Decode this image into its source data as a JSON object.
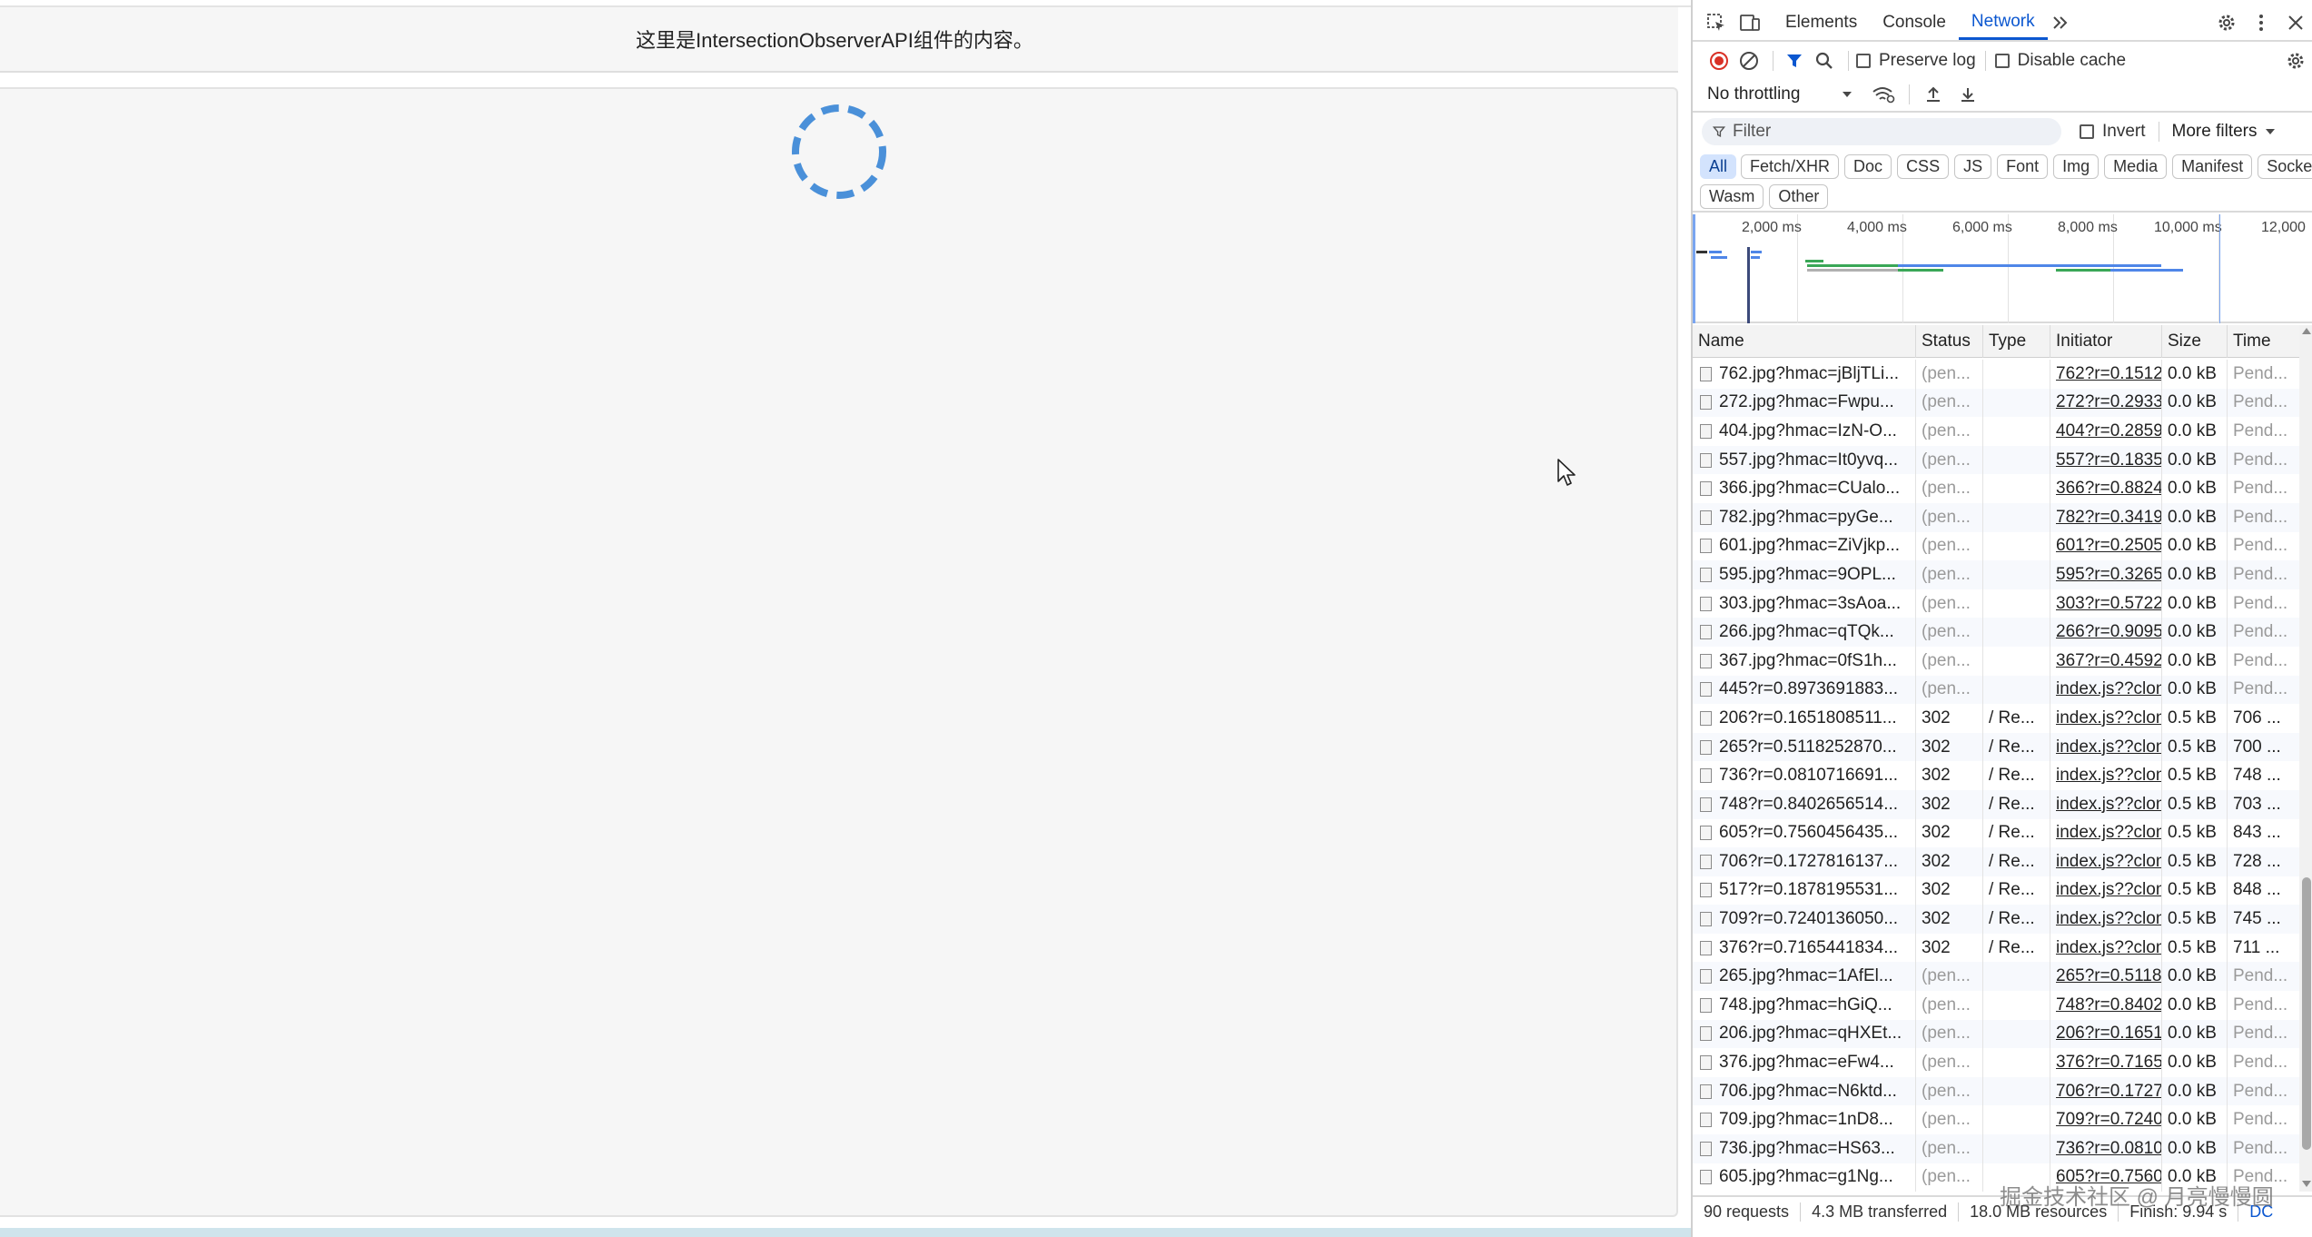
{
  "page": {
    "header_text": "这里是IntersectionObserverAPI组件的内容。"
  },
  "devtools": {
    "tabs": [
      "Elements",
      "Console",
      "Network"
    ],
    "active_tab": "Network",
    "toolbar": {
      "preserve_log": "Preserve log",
      "disable_cache": "Disable cache",
      "throttling": "No throttling"
    },
    "filter": {
      "placeholder": "Filter",
      "invert": "Invert",
      "more_filters": "More filters"
    },
    "type_filters_row1": [
      "All",
      "Fetch/XHR",
      "Doc",
      "CSS",
      "JS",
      "Font",
      "Img",
      "Media",
      "Manifest",
      "Socket"
    ],
    "type_filters_row2": [
      "Wasm",
      "Other"
    ],
    "overview_ticks": [
      "2,000 ms",
      "4,000 ms",
      "6,000 ms",
      "8,000 ms",
      "10,000 ms",
      "12,000"
    ],
    "columns": [
      "Name",
      "Status",
      "Type",
      "Initiator",
      "Size",
      "Time"
    ],
    "rows": [
      [
        "762.jpg?hmac=jBljTLi...",
        "(pen...",
        "",
        "762?r=0.1512",
        "0.0 kB",
        "Pend..."
      ],
      [
        "272.jpg?hmac=Fwpu...",
        "(pen...",
        "",
        "272?r=0.2933",
        "0.0 kB",
        "Pend..."
      ],
      [
        "404.jpg?hmac=IzN-O...",
        "(pen...",
        "",
        "404?r=0.2859",
        "0.0 kB",
        "Pend..."
      ],
      [
        "557.jpg?hmac=It0yvq...",
        "(pen...",
        "",
        "557?r=0.1835",
        "0.0 kB",
        "Pend..."
      ],
      [
        "366.jpg?hmac=CUalo...",
        "(pen...",
        "",
        "366?r=0.8824",
        "0.0 kB",
        "Pend..."
      ],
      [
        "782.jpg?hmac=pyGe...",
        "(pen...",
        "",
        "782?r=0.3419",
        "0.0 kB",
        "Pend..."
      ],
      [
        "601.jpg?hmac=ZiVjkp...",
        "(pen...",
        "",
        "601?r=0.2505",
        "0.0 kB",
        "Pend..."
      ],
      [
        "595.jpg?hmac=9OPL...",
        "(pen...",
        "",
        "595?r=0.3265",
        "0.0 kB",
        "Pend..."
      ],
      [
        "303.jpg?hmac=3sAoa...",
        "(pen...",
        "",
        "303?r=0.5722",
        "0.0 kB",
        "Pend..."
      ],
      [
        "266.jpg?hmac=qTQk...",
        "(pen...",
        "",
        "266?r=0.9095",
        "0.0 kB",
        "Pend..."
      ],
      [
        "367.jpg?hmac=0fS1h...",
        "(pen...",
        "",
        "367?r=0.4592",
        "0.0 kB",
        "Pend..."
      ],
      [
        "445?r=0.8973691883...",
        "(pen...",
        "",
        "index.js??clon",
        "0.0 kB",
        "Pend..."
      ],
      [
        "206?r=0.1651808511...",
        "302",
        "/ Re...",
        "index.js??clon",
        "0.5 kB",
        "706 ..."
      ],
      [
        "265?r=0.5118252870...",
        "302",
        "/ Re...",
        "index.js??clon",
        "0.5 kB",
        "700 ..."
      ],
      [
        "736?r=0.0810716691...",
        "302",
        "/ Re...",
        "index.js??clon",
        "0.5 kB",
        "748 ..."
      ],
      [
        "748?r=0.8402656514...",
        "302",
        "/ Re...",
        "index.js??clon",
        "0.5 kB",
        "703 ..."
      ],
      [
        "605?r=0.7560456435...",
        "302",
        "/ Re...",
        "index.js??clon",
        "0.5 kB",
        "843 ..."
      ],
      [
        "706?r=0.1727816137...",
        "302",
        "/ Re...",
        "index.js??clon",
        "0.5 kB",
        "728 ..."
      ],
      [
        "517?r=0.1878195531...",
        "302",
        "/ Re...",
        "index.js??clon",
        "0.5 kB",
        "848 ..."
      ],
      [
        "709?r=0.7240136050...",
        "302",
        "/ Re...",
        "index.js??clon",
        "0.5 kB",
        "745 ..."
      ],
      [
        "376?r=0.7165441834...",
        "302",
        "/ Re...",
        "index.js??clon",
        "0.5 kB",
        "711 ..."
      ],
      [
        "265.jpg?hmac=1AfEl...",
        "(pen...",
        "",
        "265?r=0.5118",
        "0.0 kB",
        "Pend..."
      ],
      [
        "748.jpg?hmac=hGiQ...",
        "(pen...",
        "",
        "748?r=0.8402",
        "0.0 kB",
        "Pend..."
      ],
      [
        "206.jpg?hmac=qHXEt...",
        "(pen...",
        "",
        "206?r=0.1651",
        "0.0 kB",
        "Pend..."
      ],
      [
        "376.jpg?hmac=eFw4...",
        "(pen...",
        "",
        "376?r=0.7165",
        "0.0 kB",
        "Pend..."
      ],
      [
        "706.jpg?hmac=N6ktd...",
        "(pen...",
        "",
        "706?r=0.1727",
        "0.0 kB",
        "Pend..."
      ],
      [
        "709.jpg?hmac=1nD8...",
        "(pen...",
        "",
        "709?r=0.7240",
        "0.0 kB",
        "Pend..."
      ],
      [
        "736.jpg?hmac=HS63...",
        "(pen...",
        "",
        "736?r=0.0810",
        "0.0 kB",
        "Pend..."
      ],
      [
        "605.jpg?hmac=g1Ng...",
        "(pen...",
        "",
        "605?r=0.7560",
        "0.0 kB",
        "Pend..."
      ]
    ],
    "statusbar": {
      "requests": "90 requests",
      "transferred": "4.3 MB transferred",
      "resources": "18.0 MB resources",
      "finish": "Finish: 9.94 s",
      "dcl": "DC"
    }
  },
  "watermark": "掘金技术社区 @ 月亮慢慢圆",
  "colors": {
    "accent": "#0b57d0",
    "record_red": "#d93025",
    "spinner_blue": "#4a90d9",
    "timeline_blue": "#4f86e8",
    "timeline_green": "#3aa757"
  }
}
